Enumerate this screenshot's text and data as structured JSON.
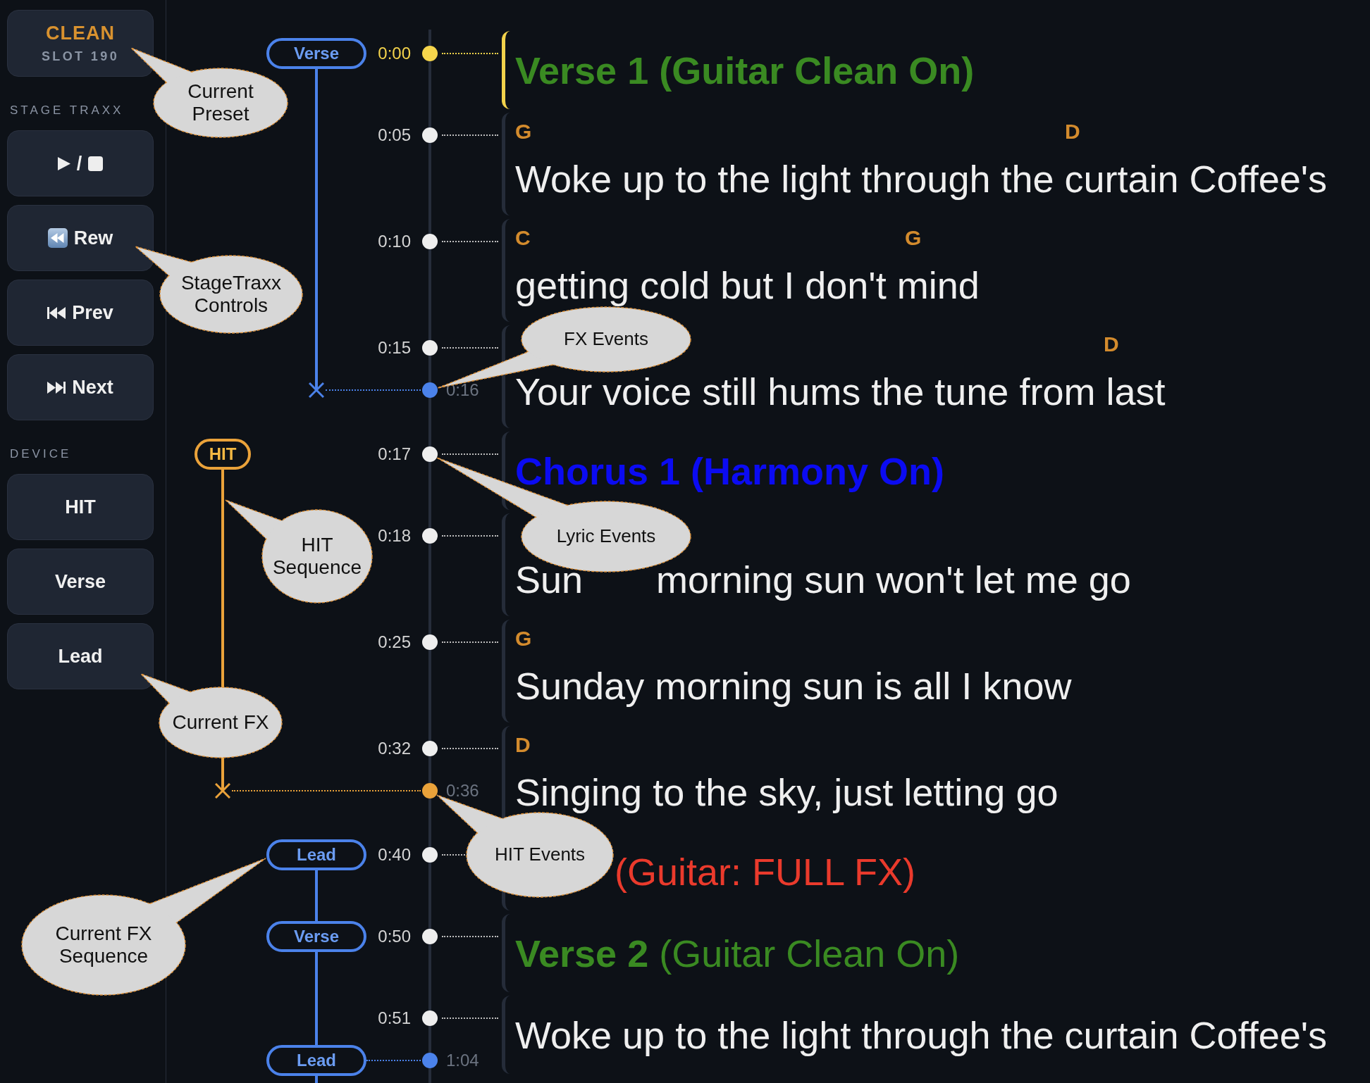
{
  "sidebar": {
    "preset": {
      "name": "CLEAN",
      "slot": "SLOT 190"
    },
    "sections": [
      {
        "title": "STAGE TRAXX",
        "buttons": [
          {
            "kind": "play_stop",
            "label": "/"
          },
          {
            "kind": "rewind",
            "label": "Rew"
          },
          {
            "kind": "previous",
            "label": "Prev"
          },
          {
            "kind": "next",
            "label": "Next"
          }
        ]
      },
      {
        "title": "DEVICE",
        "buttons": [
          {
            "kind": "text",
            "label": "HIT"
          },
          {
            "kind": "text",
            "label": "Verse"
          },
          {
            "kind": "text",
            "label": "Lead"
          }
        ]
      }
    ]
  },
  "timeline": {
    "rows": [
      {
        "time": "0:00",
        "current": true,
        "fx_event": {
          "kind": "pill",
          "label": "Verse"
        },
        "block": {
          "kind": "heading",
          "text": "Verse 1 (Guitar Clean On)",
          "bold": true,
          "color": "#3a8a22"
        }
      },
      {
        "time": "0:05",
        "current": false,
        "block": {
          "kind": "chords",
          "chords": [
            "G",
            "D"
          ],
          "lyric": [
            "Woke up to the light through the curtain Coffee's"
          ]
        }
      },
      {
        "time": "0:10",
        "current": false,
        "block": {
          "kind": "chords",
          "chords": [
            "C",
            "G"
          ],
          "lyric": [
            "getting cold but I don't mind"
          ]
        }
      },
      {
        "time": "0:15",
        "current": false,
        "marker": {
          "time": "0:16",
          "fx_event": {
            "kind": "end"
          }
        },
        "block": {
          "kind": "chords",
          "chords": [
            "D"
          ],
          "lyric": [
            "Your voice still hums the tune from last"
          ]
        }
      },
      {
        "time": "0:17",
        "current": false,
        "hit_event": {
          "kind": "pill",
          "label": "HIT"
        },
        "block": {
          "kind": "heading",
          "text": "Chorus 1 (Harmony On)",
          "bold": true,
          "color": "#0b0bf2"
        }
      },
      {
        "time": "0:18",
        "current": false,
        "block": {
          "kind": "chords",
          "lyric": [
            "Sun",
            "morning sun won't let me go"
          ]
        }
      },
      {
        "time": "0:25",
        "current": false,
        "block": {
          "kind": "chords",
          "chords": [
            "G"
          ],
          "lyric": [
            "Sunday morning sun is all I know"
          ]
        }
      },
      {
        "time": "0:32",
        "current": false,
        "marker": {
          "time": "0:36",
          "hit_event": {
            "kind": "end"
          }
        },
        "block": {
          "kind": "chords",
          "chords": [
            "D"
          ],
          "lyric": [
            "Singing to the sky, just letting go"
          ]
        }
      },
      {
        "time": "0:40",
        "current": false,
        "fx_event": {
          "kind": "pill",
          "label": "Lead"
        },
        "block": {
          "kind": "heading",
          "text": "(Guitar: FULL FX)",
          "bold": false,
          "color": "#ea3a2c"
        }
      },
      {
        "time": "0:50",
        "current": false,
        "fx_event": {
          "kind": "pill",
          "label": "Verse"
        },
        "block": {
          "kind": "heading",
          "text": "**Verse 2** (Guitar Clean On)",
          "bold": false,
          "color": "#3a8a22"
        }
      },
      {
        "time": "0:51",
        "current": false,
        "marker": {
          "time": "1:04",
          "fx_event": {
            "kind": "pill",
            "label": "Lead"
          }
        },
        "block": {
          "kind": "plain",
          "lyric": [
            "Woke up to the light through the curtain Coffee's"
          ]
        }
      }
    ]
  },
  "callouts": [
    {
      "text": "Current Preset"
    },
    {
      "text": "StageTraxx Controls"
    },
    {
      "text": "FX Events"
    },
    {
      "text": "Lyric Events"
    },
    {
      "text": "HIT Sequence"
    },
    {
      "text": "Current FX"
    },
    {
      "text": "HIT Events"
    },
    {
      "text": "Current FX Sequence"
    }
  ]
}
